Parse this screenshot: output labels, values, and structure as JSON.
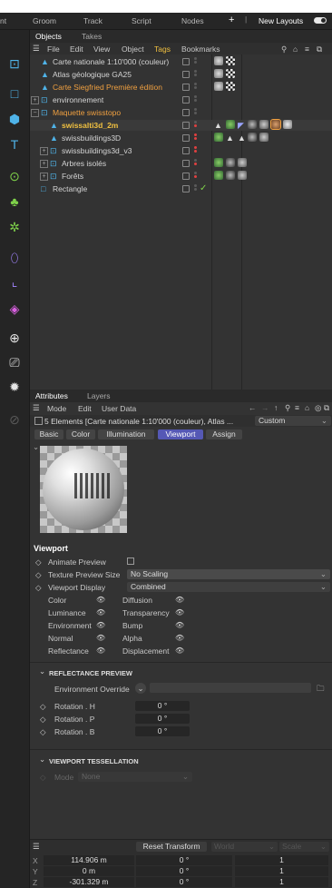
{
  "topbar": {
    "items": [
      "nt",
      "Groom",
      "Track",
      "Script",
      "Nodes",
      "+",
      "New Layouts"
    ]
  },
  "objects": {
    "tabs": [
      "Objects",
      "Takes"
    ],
    "menu": [
      "File",
      "Edit",
      "View",
      "Object",
      "Tags",
      "Bookmarks"
    ],
    "rows": [
      {
        "label": "Carte nationale 1:10'000 (couleur)",
        "color": "#d4d4d4"
      },
      {
        "label": "Atlas géologique GA25",
        "color": "#d4d4d4"
      },
      {
        "label": "Carte Siegfried Première édition",
        "color": "#f0a040"
      },
      {
        "label": "environnement",
        "color": "#d4d4d4"
      },
      {
        "label": "Maquette swisstopo",
        "color": "#f0a040"
      },
      {
        "label": "swissalti3d_2m",
        "color": "#f0c040"
      },
      {
        "label": "swissbuildings3D",
        "color": "#d4d4d4"
      },
      {
        "label": "swissbuildings3d_v3",
        "color": "#d4d4d4"
      },
      {
        "label": "Arbres isolés",
        "color": "#d4d4d4"
      },
      {
        "label": "Forêts",
        "color": "#d4d4d4"
      },
      {
        "label": "Rectangle",
        "color": "#d4d4d4"
      }
    ]
  },
  "attributes": {
    "tabs": [
      "Attributes",
      "Layers"
    ],
    "menu": [
      "Mode",
      "Edit",
      "User Data"
    ],
    "selection": "5 Elements [Carte nationale 1:10'000 (couleur), Atlas ...",
    "preset": "Custom",
    "subtabs": [
      "Basic",
      "Color",
      "Illumination",
      "Viewport",
      "Assign"
    ],
    "viewport_title": "Viewport",
    "animate_preview": "Animate Preview",
    "texture_preview_size": "Texture Preview Size",
    "texture_value": "No Scaling",
    "viewport_display": "Viewport Display",
    "display_value": "Combined",
    "channels_left": [
      "Color",
      "Luminance",
      "Environment",
      "Normal",
      "Reflectance"
    ],
    "channels_right": [
      "Diffusion",
      "Transparency",
      "Bump",
      "Alpha",
      "Displacement"
    ],
    "reflectance_title": "REFLECTANCE PREVIEW",
    "env_override": "Environment Override",
    "rotations": [
      {
        "label": "Rotation . H",
        "value": "0 °"
      },
      {
        "label": "Rotation . P",
        "value": "0 °"
      },
      {
        "label": "Rotation . B",
        "value": "0 °"
      }
    ],
    "tess_title": "VIEWPORT TESSELLATION",
    "mode_label": "Mode",
    "mode_value": "None"
  },
  "coords": {
    "reset": "Reset Transform",
    "world": "World",
    "scale": "Scale",
    "rows": [
      {
        "axis": "X",
        "pos": "114.906 m",
        "rot": "0 °",
        "scale": "1"
      },
      {
        "axis": "Y",
        "pos": "0 m",
        "rot": "0 °",
        "scale": "1"
      },
      {
        "axis": "Z",
        "pos": "-301.329 m",
        "rot": "0 °",
        "scale": "1"
      }
    ]
  },
  "colors": {
    "accent": "#5558b5",
    "orange": "#f0a040",
    "blue": "#4fb3e8"
  }
}
